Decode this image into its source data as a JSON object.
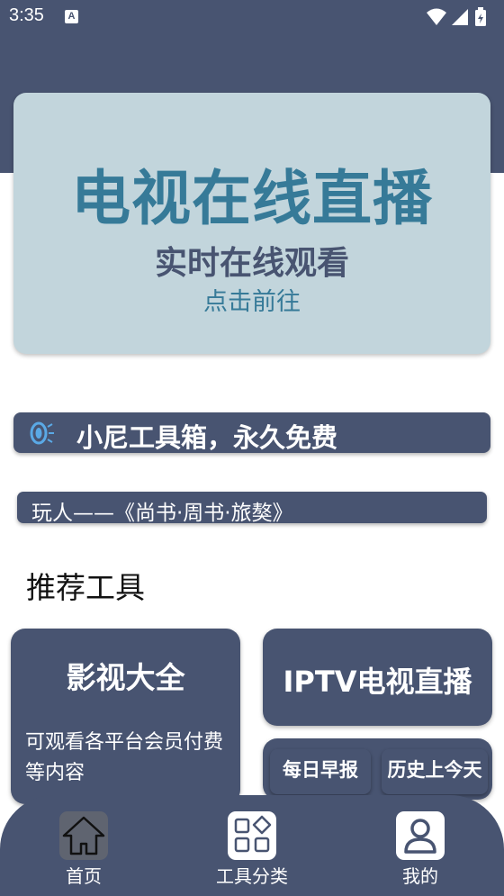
{
  "status_bar": {
    "time": "3:35",
    "notification_icon": "a-letter-icon",
    "icons": [
      "wifi-icon",
      "signal-icon",
      "battery-icon"
    ]
  },
  "banner": {
    "title": "电视在线直播",
    "subtitle": "实时在线观看",
    "action": "点击前往"
  },
  "notice": {
    "icon": "speaker-icon",
    "text": "小尼工具箱，永久免费"
  },
  "quote": {
    "text": "玩人——《尚书·周书·旅獒》"
  },
  "section": {
    "heading": "推荐工具"
  },
  "cards": {
    "video": {
      "title": "影视大全",
      "description": "可观看各平台会员付费等内容"
    },
    "iptv": {
      "title": "IPTV电视直播"
    },
    "daily": {
      "label": "每日早报"
    },
    "history": {
      "label": "历史上今天"
    }
  },
  "bottom_nav": {
    "items": [
      {
        "label": "首页",
        "icon": "home-icon",
        "active": true
      },
      {
        "label": "工具分类",
        "icon": "grid-icon",
        "active": false
      },
      {
        "label": "我的",
        "icon": "user-icon",
        "active": false
      }
    ]
  },
  "colors": {
    "primary": "#485471",
    "banner_bg": "#c2d5dc",
    "banner_accent": "#367a98"
  }
}
